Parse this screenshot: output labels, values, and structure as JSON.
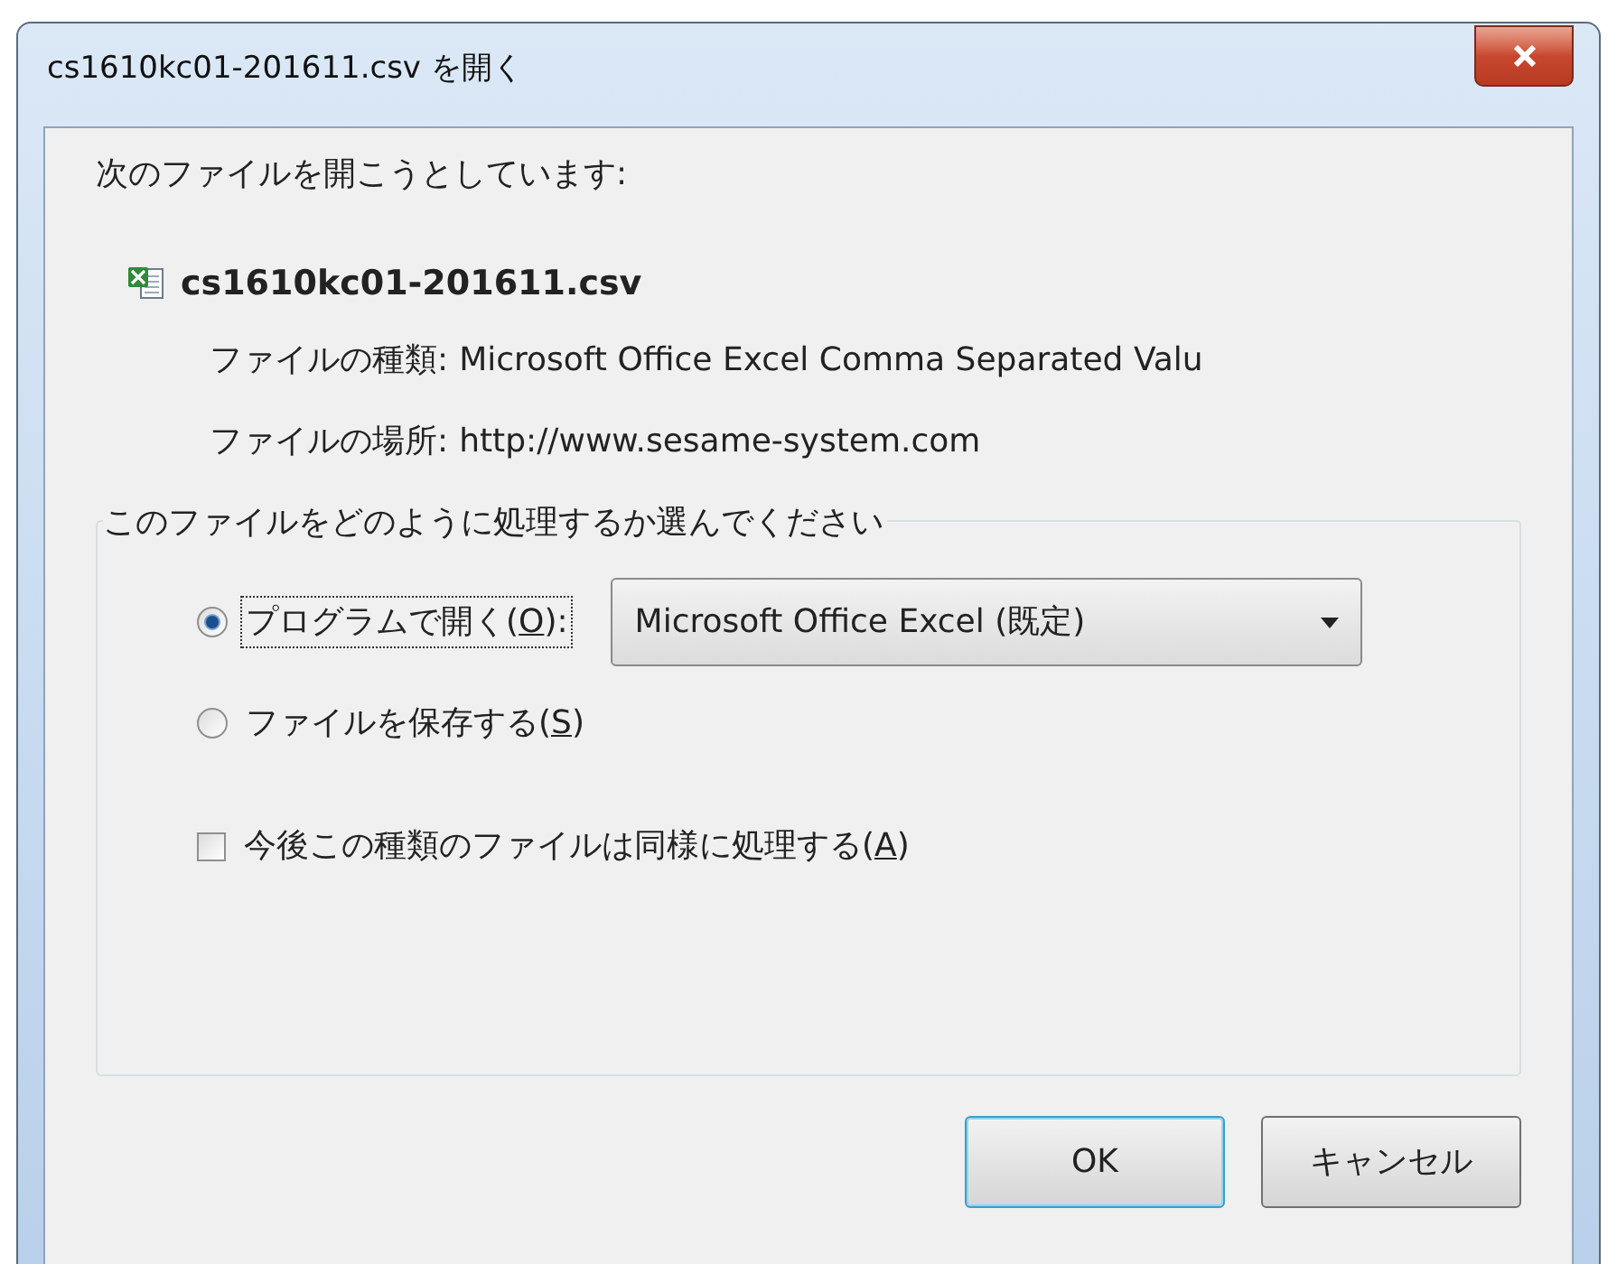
{
  "window": {
    "title": "cs1610kc01-201611.csv を開く"
  },
  "intro": "次のファイルを開こうとしています:",
  "file": {
    "name": "cs1610kc01-201611.csv",
    "details": [
      {
        "label": "ファイルの種類:",
        "value": "Microsoft Office Excel Comma Separated Valu"
      },
      {
        "label": "ファイルの場所:",
        "value": "http://www.sesame-system.com"
      }
    ]
  },
  "group": {
    "title": "このファイルをどのように処理するか選んでください",
    "options": [
      {
        "kind": "radio",
        "before": "プログラムで開く(",
        "key": "O",
        "after": "):",
        "selected": true,
        "focused": true,
        "dropdown": "Microsoft Office Excel (既定)"
      },
      {
        "kind": "radio",
        "before": "ファイルを保存する(",
        "key": "S",
        "after": ")",
        "selected": false,
        "focused": false
      },
      {
        "kind": "checkbox",
        "before": "今後この種類のファイルは同様に処理する(",
        "key": "A",
        "after": ")",
        "checked": false,
        "focused": false
      }
    ]
  },
  "buttons": [
    {
      "label": "OK",
      "default": true
    },
    {
      "label": "キャンセル",
      "default": false
    }
  ]
}
